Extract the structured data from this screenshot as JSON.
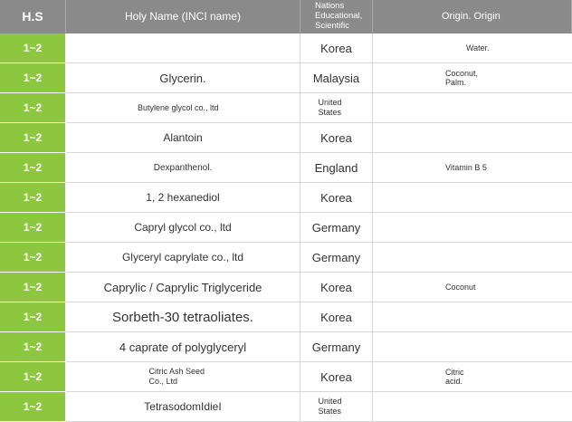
{
  "header": {
    "hs": "H.S",
    "name": "Holy Name (INCI name)",
    "country": "Nations Educational, Scientific",
    "origin": "Origin. Origin"
  },
  "rows": [
    {
      "hs": "1~2",
      "name": "",
      "country": "Korea",
      "origin": "Water."
    },
    {
      "hs": "1~2",
      "name": "Glycerin.",
      "country": "Malaysia",
      "origin": "Coconut, Palm."
    },
    {
      "hs": "1~2",
      "name": "Butylene glycol co., ltd",
      "country": "United States",
      "origin": ""
    },
    {
      "hs": "1~2",
      "name": "Alantoin",
      "country": "Korea",
      "origin": ""
    },
    {
      "hs": "1~2",
      "name": "Dexpanthenol.",
      "country": "England",
      "origin": "Vitamin B 5"
    },
    {
      "hs": "1~2",
      "name": "1, 2 hexanediol",
      "country": "Korea",
      "origin": ""
    },
    {
      "hs": "1~2",
      "name": "Capryl glycol co., ltd",
      "country": "Germany",
      "origin": ""
    },
    {
      "hs": "1~2",
      "name": "Glyceryl caprylate co., ltd",
      "country": "Germany",
      "origin": ""
    },
    {
      "hs": "1~2",
      "name": "Caprylic / Caprylic Triglyceride",
      "country": "Korea",
      "origin": "Coconut"
    },
    {
      "hs": "1~2",
      "name": "Sorbeth-30 tetraoliates.",
      "country": "Korea",
      "origin": ""
    },
    {
      "hs": "1~2",
      "name": "4 caprate of polyglyceryl",
      "country": "Germany",
      "origin": ""
    },
    {
      "hs": "1~2",
      "name": "Citric Ash Seed Co., Ltd",
      "country": "Korea",
      "origin": "Citric acid."
    },
    {
      "hs": "1~2",
      "name": "TetrasodomIdieI",
      "country": "United States",
      "origin": ""
    }
  ]
}
